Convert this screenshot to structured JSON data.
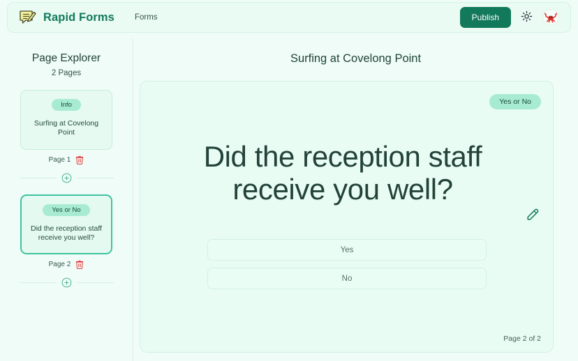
{
  "header": {
    "logo_icon": "form-pencil-logo-icon",
    "brand_name": "Rapid Forms",
    "nav_link": "Forms",
    "publish_label": "Publish",
    "theme_icon": "sun-icon",
    "avatar_icon": "crab-avatar"
  },
  "sidebar": {
    "title": "Page Explorer",
    "count_label": "2 Pages",
    "pages": [
      {
        "chip": "Info",
        "text": "Surfing at Covelong Point",
        "meta": "Page 1",
        "delete_icon": "trash-icon",
        "selected": false
      },
      {
        "chip": "Yes or No",
        "text": "Did the reception staff receive you well?",
        "meta": "Page 2",
        "delete_icon": "trash-icon",
        "selected": true
      }
    ],
    "add_icon": "plus-circle-icon"
  },
  "main": {
    "form_title": "Surfing at Covelong Point",
    "question_type_chip": "Yes or No",
    "question": "Did the reception staff receive you well?",
    "edit_icon": "pencil-icon",
    "options": [
      "Yes",
      "No"
    ],
    "page_indicator": "Page 2 of 2"
  },
  "colors": {
    "brand_green": "#13795b",
    "publish_green": "#12795a",
    "chip_green": "#a7ebd2",
    "selected_border": "#3fc2a0",
    "delete_red": "#e23b3b",
    "page_bg": "#effcf7"
  }
}
